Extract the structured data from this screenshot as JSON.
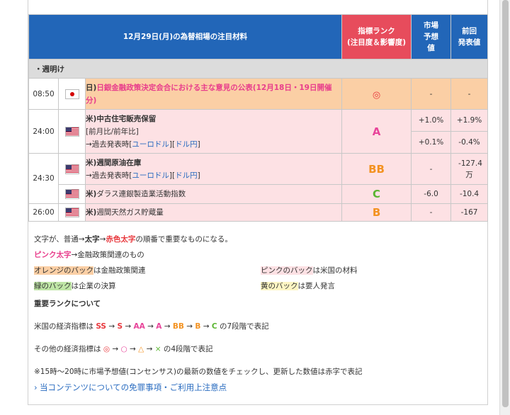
{
  "header": {
    "title": "12月29日(月)の為替相場の注目材料",
    "rank_col": "指標ランク\n(注目度＆影響度)",
    "forecast_col": "市場\n予想\n値",
    "previous_col": "前回\n発表値"
  },
  "section": {
    "label": "・週明け"
  },
  "rows": [
    {
      "time": "08:50",
      "country": "日)",
      "flag": "jp-flag-icon",
      "event": "日銀金融政策決定会合における主な意見の公表(12月18日・19日開催分)",
      "rank": "◎",
      "forecast": "-",
      "previous": "-"
    },
    {
      "time": "24:00",
      "country": "米)",
      "flag": "us-flag-icon",
      "event": "中古住宅販売保留",
      "sub1": "[前月比/前年比]",
      "sub2_prefix": "→過去発表時[",
      "link1": "ユーロドル",
      "mid": "][",
      "link2": "ドル円",
      "sub2_suffix": "]",
      "rank": "A",
      "forecast_a": "+1.0%",
      "previous_a": "+1.9%",
      "forecast_b": "+0.1%",
      "previous_b": "-0.4%"
    },
    {
      "time": "24:30",
      "country": "米)",
      "flag": "us-flag-icon",
      "event": "週間原油在庫",
      "sub2_prefix": "→過去発表時[",
      "link1": "ユーロドル",
      "mid": "][",
      "link2": "ドル円",
      "sub2_suffix": "]",
      "rank": "BB",
      "forecast": "-",
      "previous": "-127.4万"
    },
    {
      "country": "米)",
      "flag": "us-flag-icon",
      "event": "ダラス連銀製造業活動指数",
      "rank": "C",
      "forecast": "-6.0",
      "previous": "-10.4"
    },
    {
      "time": "26:00",
      "country": "米)",
      "flag": "us-flag-icon",
      "event": "週間天然ガス貯蔵量",
      "rank": "B",
      "forecast": "-",
      "previous": "-167"
    }
  ],
  "notes": {
    "line1_a": "文字が、普通→",
    "line1_b": "太字",
    "line1_c": "→",
    "line1_d": "赤色太字",
    "line1_e": "の順番で重要なものになる。",
    "line2_a": "ピンク太字",
    "line2_b": "→金融政策関連のもの",
    "orange_a": "オレンジのバック",
    "orange_b": "は金融政策関連",
    "pink_a": "ピンクのバック",
    "pink_b": "は米国の材料",
    "green_a": "緑のバック",
    "green_b": "は企業の決算",
    "yellow_a": "黄のバック",
    "yellow_b": "は要人発言",
    "rank_heading": "重要ランクについて",
    "us_a": "米国の経済指標は ",
    "us_ranks": [
      "SS",
      "S",
      "AA",
      "A",
      "BB",
      "B",
      "C"
    ],
    "us_b": " の7段階で表記",
    "other_a": "その他の経済指標は ",
    "other_marks": [
      "◎",
      "○",
      "△",
      "×"
    ],
    "other_b": " の4段階で表記",
    "consensus": "※15時～20時に市場予想値(コンセンサス)の最新の数値をチェックし、更新した数値は赤字で表記",
    "disclaimer_link": "当コンテンツについての免罪事項・ご利用上注意点"
  }
}
